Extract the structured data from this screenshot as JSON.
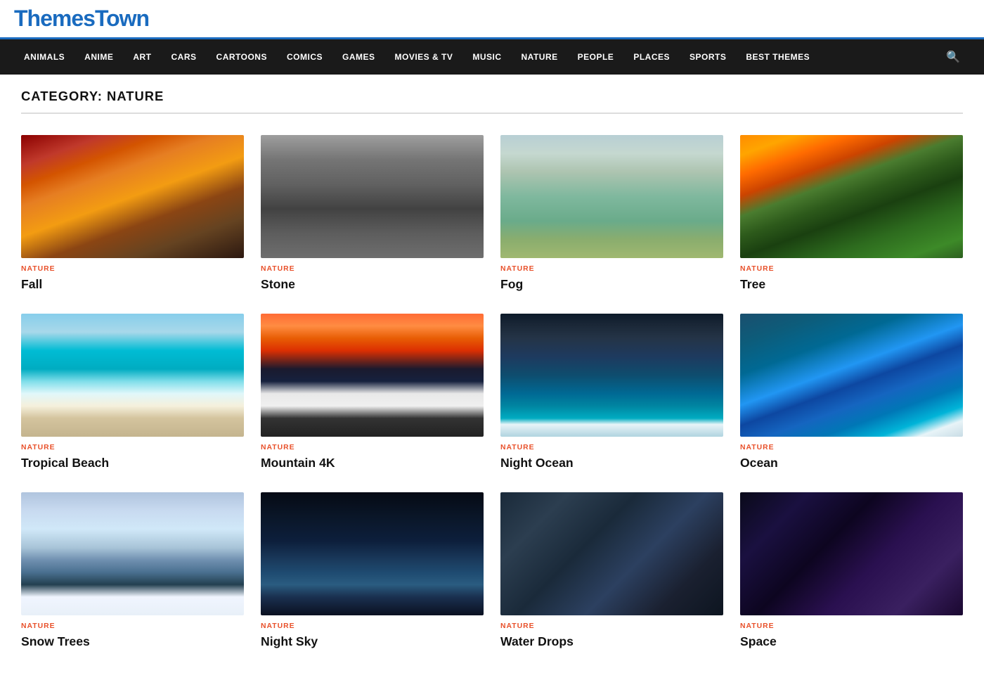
{
  "site": {
    "logo": "ThemesTown",
    "category_title": "CATEGORY: NATURE"
  },
  "nav": {
    "items": [
      {
        "label": "ANIMALS",
        "href": "#"
      },
      {
        "label": "ANIME",
        "href": "#"
      },
      {
        "label": "ART",
        "href": "#"
      },
      {
        "label": "CARS",
        "href": "#"
      },
      {
        "label": "CARTOONS",
        "href": "#"
      },
      {
        "label": "COMICS",
        "href": "#"
      },
      {
        "label": "GAMES",
        "href": "#"
      },
      {
        "label": "MOVIES & TV",
        "href": "#"
      },
      {
        "label": "MUSIC",
        "href": "#"
      },
      {
        "label": "NATURE",
        "href": "#"
      },
      {
        "label": "PEOPLE",
        "href": "#"
      },
      {
        "label": "PLACES",
        "href": "#"
      },
      {
        "label": "SPORTS",
        "href": "#"
      },
      {
        "label": "BEST THEMES",
        "href": "#"
      }
    ]
  },
  "cards": [
    {
      "category": "NATURE",
      "title": "Fall",
      "img_class": "img-fall"
    },
    {
      "category": "NATURE",
      "title": "Stone",
      "img_class": "img-stone"
    },
    {
      "category": "NATURE",
      "title": "Fog",
      "img_class": "img-fog"
    },
    {
      "category": "NATURE",
      "title": "Tree",
      "img_class": "img-tree"
    },
    {
      "category": "NATURE",
      "title": "Tropical Beach",
      "img_class": "img-beach"
    },
    {
      "category": "NATURE",
      "title": "Mountain 4K",
      "img_class": "img-mountain"
    },
    {
      "category": "NATURE",
      "title": "Night Ocean",
      "img_class": "img-night-ocean"
    },
    {
      "category": "NATURE",
      "title": "Ocean",
      "img_class": "img-ocean"
    },
    {
      "category": "NATURE",
      "title": "Snow Trees",
      "img_class": "img-snow-trees"
    },
    {
      "category": "NATURE",
      "title": "Night Sky",
      "img_class": "img-night-sky"
    },
    {
      "category": "NATURE",
      "title": "Water Drops",
      "img_class": "img-water-drops"
    },
    {
      "category": "NATURE",
      "title": "Space",
      "img_class": "img-space"
    }
  ]
}
